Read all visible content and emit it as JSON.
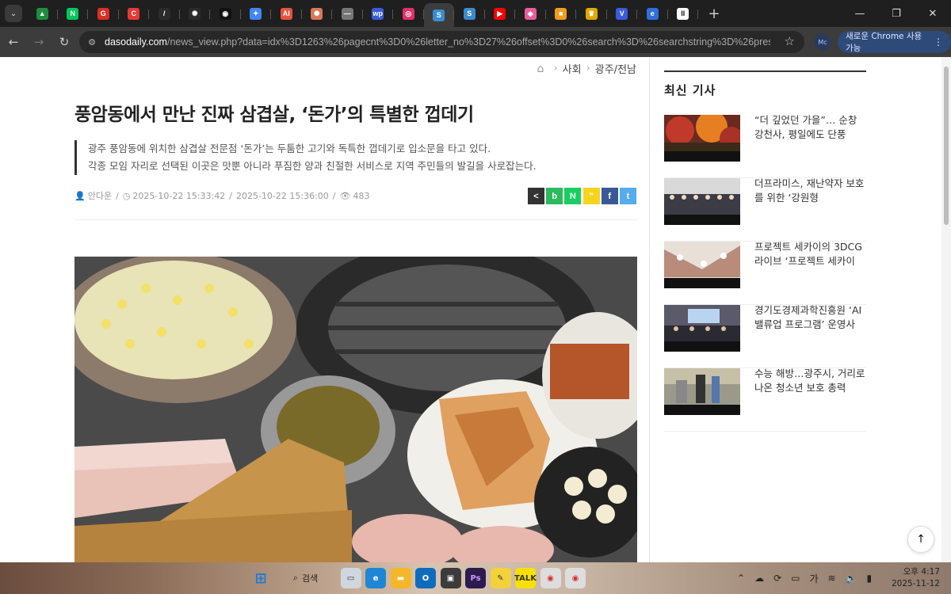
{
  "tabs": [
    {
      "icon": "drive-icon",
      "color": "#1e8e3e",
      "glyph": "▲"
    },
    {
      "icon": "naver-icon",
      "color": "#03c75a",
      "glyph": "N"
    },
    {
      "icon": "chrome-c-icon",
      "color": "#d93025",
      "glyph": "G"
    },
    {
      "icon": "c-red-icon",
      "color": "#e53935",
      "glyph": "C"
    },
    {
      "icon": "slash-icon",
      "color": "#2b2b2b",
      "glyph": "/"
    },
    {
      "icon": "openai-icon",
      "color": "#2b2b2b",
      "glyph": "✺"
    },
    {
      "icon": "ai-tool-icon",
      "color": "#111111",
      "glyph": "◉"
    },
    {
      "icon": "gemini-icon",
      "color": "#4285f4",
      "glyph": "✦"
    },
    {
      "icon": "ai-red-icon",
      "color": "#e5533d",
      "glyph": "AI"
    },
    {
      "icon": "claude-icon",
      "color": "#d97757",
      "glyph": "✺"
    },
    {
      "icon": "gray-tab-icon",
      "color": "#777777",
      "glyph": "—"
    },
    {
      "icon": "wp-icon",
      "color": "#3a5bd9",
      "glyph": "wp"
    },
    {
      "icon": "instagram-icon",
      "color": "#e1306c",
      "glyph": "◎"
    },
    {
      "icon": "daso-icon",
      "color": "#3a8ccf",
      "glyph": "S"
    },
    {
      "icon": "daso2-icon",
      "color": "#3a8ccf",
      "glyph": "S"
    },
    {
      "icon": "youtube-icon",
      "color": "#ff0000",
      "glyph": "▶"
    },
    {
      "icon": "pink-app-icon",
      "color": "#e85d9c",
      "glyph": "◆"
    },
    {
      "icon": "orange-box-icon",
      "color": "#f29c1f",
      "glyph": "■"
    },
    {
      "icon": "gold-icon",
      "color": "#e0a800",
      "glyph": "♛"
    },
    {
      "icon": "v-icon",
      "color": "#3b5bdb",
      "glyph": "V"
    },
    {
      "icon": "edge-like-icon",
      "color": "#2f6fdb",
      "glyph": "e"
    },
    {
      "icon": "pause-icon",
      "color": "#ffffff",
      "glyph": "II"
    }
  ],
  "active_tab": 13,
  "window": {
    "minimize": "—",
    "restore": "❐",
    "close": "✕"
  },
  "nav": {
    "back": "←",
    "forward": "→",
    "reload": "↻",
    "newtab": "+",
    "menu": "⌄"
  },
  "address": {
    "host": "dasodaily.com",
    "path": "/news_view.php?data=idx%3D1263%26pagecnt%3D0%26letter_no%3D27%26offset%3D0%26search%3D%26searchstring%3D%26present_num%...",
    "star": "☆"
  },
  "profile_label": "Mc",
  "chrome_update": {
    "label": "새로운 Chrome 사용 가능",
    "more": "⋮"
  },
  "breadcrumb": {
    "home": "⌂",
    "section": "사회",
    "sub": "광주/전남",
    "sep": "›"
  },
  "article": {
    "title": "풍암동에서 만난 진짜 삼겹살, ‘돈가’의 특별한 껍데기",
    "lede1": "광주 풍암동에 위치한 삼겹살 전문점 ‘돈가’는 두툼한 고기와 독특한 껍데기로 입소문을 타고 있다.",
    "lede2": "각종 모임 자리로 선택된 이곳은 맛뿐 아니라 푸짐한 양과 친절한 서비스로 지역 주민들의 발길을 사로잡는다.",
    "author": "안다운",
    "created": "2025-10-22 15:33:42",
    "updated": "2025-10-22 15:36:00",
    "views": "483"
  },
  "share": [
    {
      "name": "share-icon",
      "color": "#333333",
      "glyph": "<"
    },
    {
      "name": "band-icon",
      "color": "#2dba5d",
      "glyph": "b"
    },
    {
      "name": "naver-share-icon",
      "color": "#19ce60",
      "glyph": "N"
    },
    {
      "name": "kakao-story-icon",
      "color": "#f7d31e",
      "glyph": "\""
    },
    {
      "name": "facebook-icon",
      "color": "#3b5998",
      "glyph": "f"
    },
    {
      "name": "twitter-icon",
      "color": "#55acee",
      "glyph": "t"
    }
  ],
  "sidebar": {
    "title": "최신 기사",
    "items": [
      {
        "title": "“더 깊었던 가을”… 순창 강천사, 평일에도 단풍"
      },
      {
        "title": "더프라미스, 재난약자 보호를 위한 ‘강원형"
      },
      {
        "title": "프로젝트 세카이의 3DCG 라이브 ‘프로젝트 세카이"
      },
      {
        "title": "경기도경제과학진흥원 ‘AI 밸류업 프로그램’ 운영사"
      },
      {
        "title": "수능 해방…광주시, 거리로 나온 청소년 보호 총력"
      }
    ]
  },
  "to_top": "↑",
  "taskbar": {
    "search": "검색",
    "time": "오후 4:17",
    "date": "2025-11-12",
    "ime": "가"
  }
}
